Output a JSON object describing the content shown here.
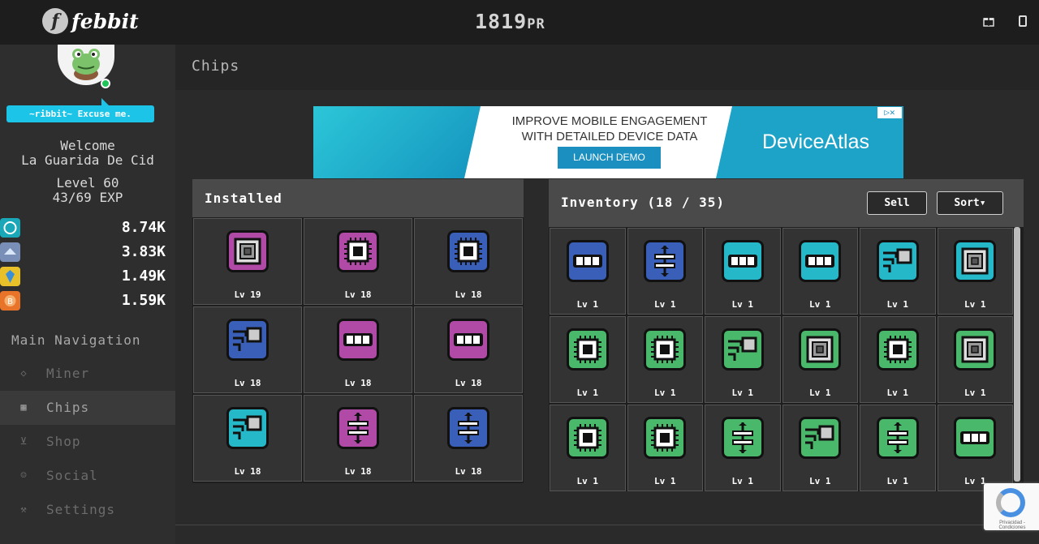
{
  "app": {
    "name": "febbit",
    "logo_letter": "f"
  },
  "header": {
    "pr_value": "1819",
    "pr_unit": "PR"
  },
  "profile": {
    "speech": "~ribbit~ Excuse me.",
    "welcome": "Welcome",
    "name": "La Guarida De Cid",
    "level": "Level 60",
    "exp": "43/69 EXP"
  },
  "currencies": [
    {
      "value": "8.74K",
      "color": "#1aa8b8",
      "icon": "coin-icon"
    },
    {
      "value": "3.83K",
      "color": "#7a8fb8",
      "icon": "crystal-icon"
    },
    {
      "value": "1.49K",
      "color": "#e8c02a",
      "icon": "gem-icon"
    },
    {
      "value": "1.59K",
      "color": "#e8742a",
      "icon": "token-icon"
    }
  ],
  "nav": {
    "title": "Main Navigation",
    "items": [
      {
        "label": "Miner",
        "icon": "diamond-icon"
      },
      {
        "label": "Chips",
        "icon": "grid-icon"
      },
      {
        "label": "Shop",
        "icon": "cart-icon"
      },
      {
        "label": "Social",
        "icon": "user-icon"
      },
      {
        "label": "Settings",
        "icon": "wrench-icon"
      }
    ]
  },
  "page": {
    "title": "Chips"
  },
  "ad": {
    "line1": "IMPROVE MOBILE ENGAGEMENT",
    "line2": "WITH DETAILED DEVICE DATA",
    "button": "LAUNCH DEMO",
    "brand": "DeviceAtlas",
    "close": "▷✕"
  },
  "installed": {
    "title": "Installed",
    "chips": [
      {
        "level": "Lv 19",
        "color": "#b04aa6",
        "design": "rings"
      },
      {
        "level": "Lv 18",
        "color": "#b04aa6",
        "design": "cpu"
      },
      {
        "level": "Lv 18",
        "color": "#3a5fb8",
        "design": "cpu"
      },
      {
        "level": "Lv 18",
        "color": "#3a5fb8",
        "design": "trace"
      },
      {
        "level": "Lv 18",
        "color": "#b04aa6",
        "design": "ram"
      },
      {
        "level": "Lv 18",
        "color": "#b04aa6",
        "design": "ram"
      },
      {
        "level": "Lv 18",
        "color": "#25b8c8",
        "design": "trace"
      },
      {
        "level": "Lv 18",
        "color": "#b04aa6",
        "design": "resistor"
      },
      {
        "level": "Lv 18",
        "color": "#3a5fb8",
        "design": "resistor"
      }
    ]
  },
  "inventory": {
    "title": "Inventory (18 / 35)",
    "sell": "Sell",
    "sort": "Sort▾",
    "chips": [
      {
        "level": "Lv 1",
        "color": "#3a5fb8",
        "design": "ram"
      },
      {
        "level": "Lv 1",
        "color": "#3a5fb8",
        "design": "resistor"
      },
      {
        "level": "Lv 1",
        "color": "#25b8c8",
        "design": "ram"
      },
      {
        "level": "Lv 1",
        "color": "#25b8c8",
        "design": "ram"
      },
      {
        "level": "Lv 1",
        "color": "#25b8c8",
        "design": "trace"
      },
      {
        "level": "Lv 1",
        "color": "#25b8c8",
        "design": "rings"
      },
      {
        "level": "Lv 1",
        "color": "#4ab86a",
        "design": "cpu"
      },
      {
        "level": "Lv 1",
        "color": "#4ab86a",
        "design": "cpu"
      },
      {
        "level": "Lv 1",
        "color": "#4ab86a",
        "design": "trace"
      },
      {
        "level": "Lv 1",
        "color": "#4ab86a",
        "design": "rings"
      },
      {
        "level": "Lv 1",
        "color": "#4ab86a",
        "design": "cpu"
      },
      {
        "level": "Lv 1",
        "color": "#4ab86a",
        "design": "rings"
      },
      {
        "level": "Lv 1",
        "color": "#4ab86a",
        "design": "cpu"
      },
      {
        "level": "Lv 1",
        "color": "#4ab86a",
        "design": "cpu"
      },
      {
        "level": "Lv 1",
        "color": "#4ab86a",
        "design": "resistor"
      },
      {
        "level": "Lv 1",
        "color": "#4ab86a",
        "design": "trace"
      },
      {
        "level": "Lv 1",
        "color": "#4ab86a",
        "design": "resistor"
      },
      {
        "level": "Lv 1",
        "color": "#4ab86a",
        "design": "ram"
      }
    ]
  },
  "recaptcha": {
    "text": "Privacidad - Condiciones"
  }
}
